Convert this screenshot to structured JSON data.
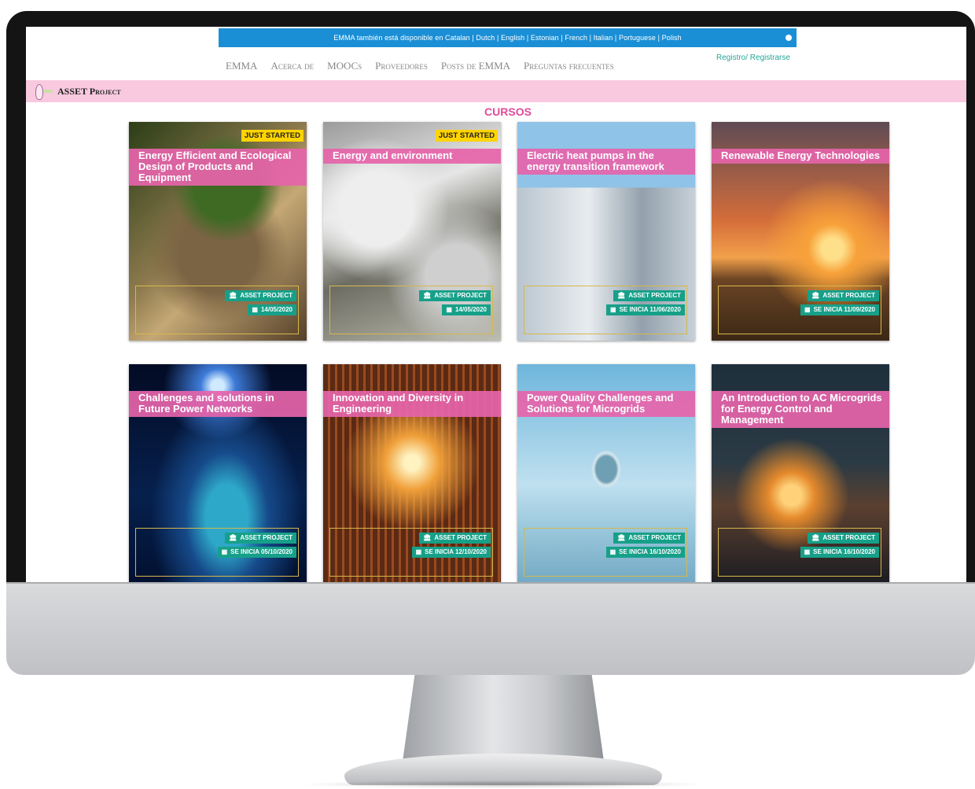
{
  "language_banner": {
    "text": "EMMA también está disponible en Catalan | Dutch | English | Estonian | French | Italian | Portuguese | Polish"
  },
  "nav": {
    "items": [
      "EMMA",
      "Acerca de",
      "MOOCs",
      "Proveedores",
      "Posts de EMMA",
      "Preguntas frecuentes"
    ]
  },
  "auth": {
    "label": "Registro/ Registrarse"
  },
  "project_bar": {
    "name": "ASSET Project"
  },
  "section": {
    "title": "CURSOS"
  },
  "courses": [
    {
      "title": "Energy Efficient and Ecological Design of Products and Equipment",
      "badge": "JUST STARTED",
      "provider": "ASSET PROJECT",
      "date": "14/05/2020"
    },
    {
      "title": "Energy and environment",
      "badge": "JUST STARTED",
      "provider": "ASSET PROJECT",
      "date": "14/05/2020"
    },
    {
      "title": "Electric heat pumps in the energy transition framework",
      "provider": "ASSET PROJECT",
      "date": "SE INICIA 11/06/2020"
    },
    {
      "title": "Renewable Energy Technologies",
      "provider": "ASSET PROJECT",
      "date": "SE INICIA 11/09/2020"
    },
    {
      "title": "Challenges and solutions in Future Power Networks",
      "provider": "ASSET PROJECT",
      "date": "SE INICIA 05/10/2020"
    },
    {
      "title": "Innovation and Diversity in Engineering",
      "provider": "ASSET PROJECT",
      "date": "SE INICIA 12/10/2020"
    },
    {
      "title": "Power Quality Challenges and Solutions for Microgrids",
      "provider": "ASSET PROJECT",
      "date": "SE INICIA 16/10/2020"
    },
    {
      "title": "An Introduction to AC Microgrids for Energy Control and Management",
      "provider": "ASSET PROJECT",
      "date": "SE INICIA 16/10/2020"
    }
  ],
  "icons": {
    "provider": "institution-icon",
    "date": "calendar-icon"
  },
  "colors": {
    "banner": "#1a8fd6",
    "pink_bar": "#f8c9df",
    "section_title": "#e14a9b",
    "title_band": "#e664aa",
    "badge": "#ffd400",
    "chip": "#17a089",
    "auth": "#26a69a"
  }
}
